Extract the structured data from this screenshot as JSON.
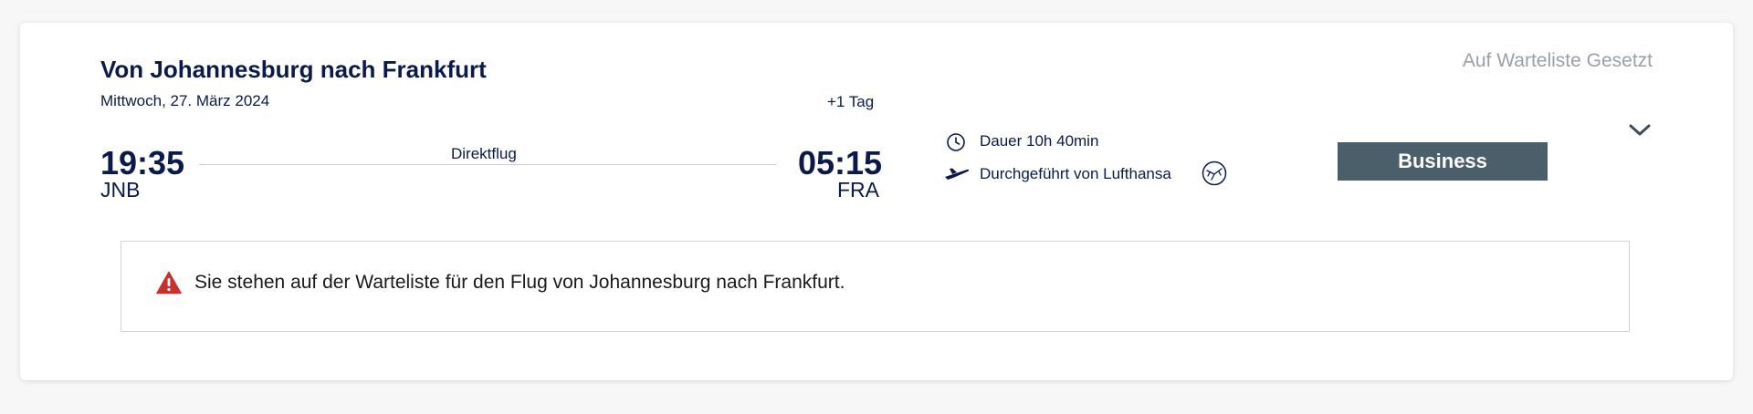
{
  "flight": {
    "title": "Von Johannesburg nach Frankfurt",
    "date": "Mittwoch, 27. März 2024",
    "status": "Auf Warteliste Gesetzt",
    "departure": {
      "time": "19:35",
      "code": "JNB"
    },
    "arrival": {
      "time": "05:15",
      "code": "FRA",
      "day_offset": "+1 Tag"
    },
    "route_label": "Direktflug",
    "duration": "Dauer 10h 40min",
    "operator": "Durchgeführt von Lufthansa",
    "cabin": "Business"
  },
  "alert": {
    "message": "Sie stehen auf der Warteliste für den Flug von Johannesburg nach Frankfurt."
  },
  "icons": {
    "duration": "clock-icon",
    "operator": "airplane-icon",
    "airline": "lufthansa-logo-icon",
    "expand": "chevron-down-icon",
    "alert": "warning-triangle-icon"
  },
  "colors": {
    "text_primary": "#0b1a4a",
    "status_grey": "#9aa0a8",
    "cabin_badge": "#4b5f6b",
    "warning_red": "#c8302c"
  }
}
